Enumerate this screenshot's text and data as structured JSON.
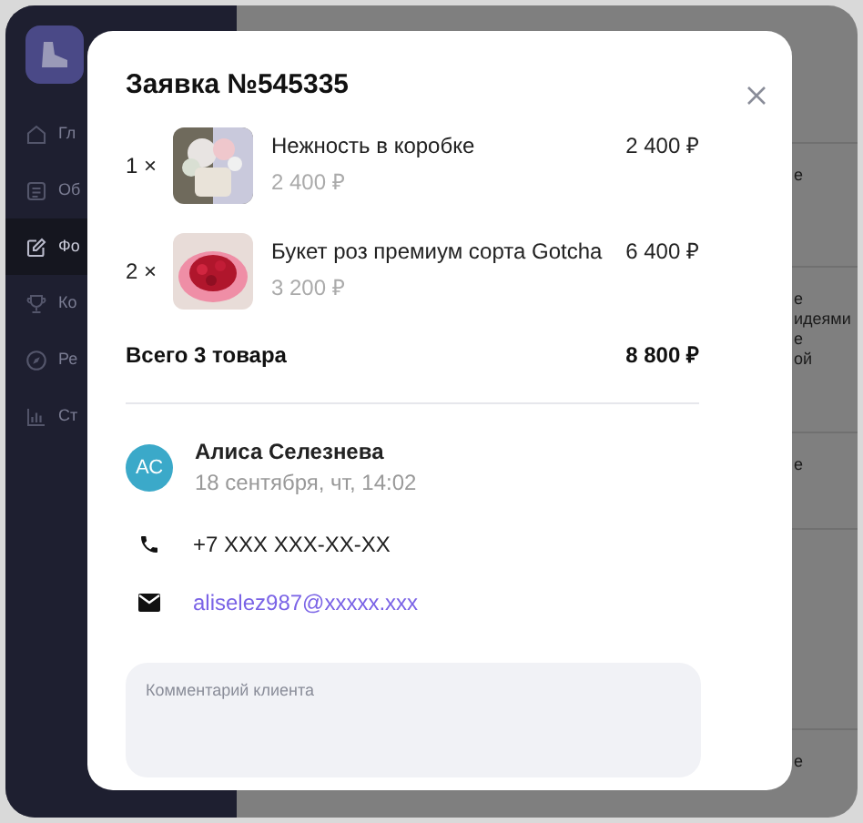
{
  "sidebar": {
    "items": [
      {
        "label": "Гл",
        "selected": false
      },
      {
        "label": "Об",
        "selected": false
      },
      {
        "label": "Фо",
        "selected": true
      },
      {
        "label": "Ко",
        "selected": false
      },
      {
        "label": "Ре",
        "selected": false
      },
      {
        "label": "Ст",
        "selected": false
      }
    ]
  },
  "background_rows": [
    {
      "lines": [
        "е"
      ]
    },
    {
      "lines": [
        "е",
        "идеями",
        "е",
        "ой"
      ]
    },
    {
      "lines": [
        "е"
      ]
    },
    {
      "lines": []
    },
    {
      "lines": [
        "е"
      ]
    }
  ],
  "modal": {
    "title": "Заявка №545335",
    "items": [
      {
        "quantity": "1 ×",
        "name": "Нежность в коробке",
        "unit_price": "2 400 ₽",
        "total": "2 400 ₽"
      },
      {
        "quantity": "2 ×",
        "name": "Букет роз премиум сорта Gotcha",
        "unit_price": "3 200 ₽",
        "total": "6 400 ₽"
      }
    ],
    "summary": {
      "label": "Всего 3 товара",
      "total": "8 800 ₽"
    },
    "customer": {
      "initials": "АС",
      "name": "Алиса Селезнева",
      "date": "18 сентября, чт, 14:02",
      "phone": "+7 XXX XXX-XX-XX",
      "email": "aliselez987@xxxxx.xxx"
    },
    "comment": {
      "placeholder": "Комментарий клиента"
    }
  }
}
